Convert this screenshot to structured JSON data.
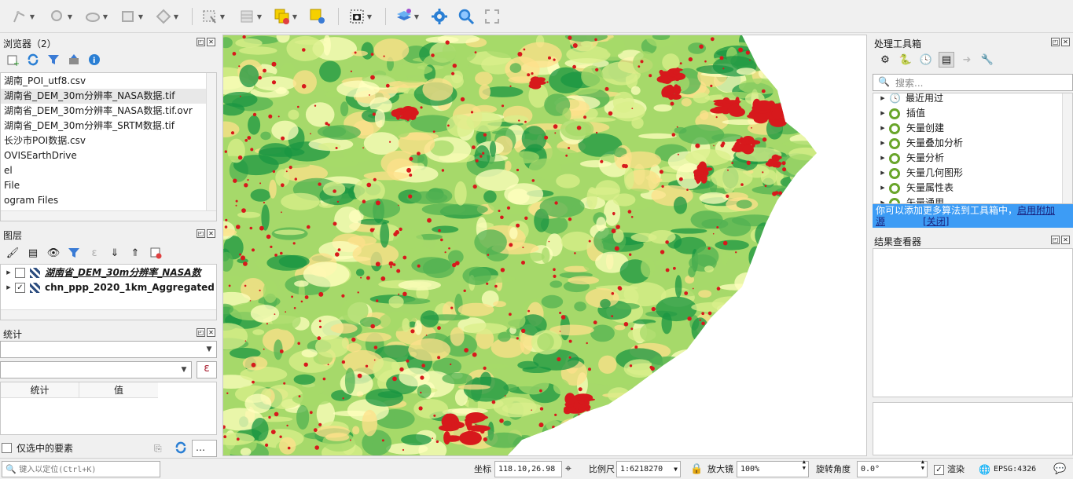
{
  "browser": {
    "title": "浏览器（2）",
    "items": [
      "湖南_POI_utf8.csv",
      "湖南省_DEM_30m分辨率_NASA数据.tif",
      "湖南省_DEM_30m分辨率_NASA数据.tif.ovr",
      "湖南省_DEM_30m分辨率_SRTM数据.tif",
      "长沙市POI数据.csv",
      "OVISEarthDrive",
      "el",
      "File",
      "ogram Files"
    ],
    "icons": [
      "add-layer-icon",
      "refresh-icon",
      "filter-icon",
      "collapse-icon",
      "info-icon"
    ]
  },
  "layers": {
    "title": "图层",
    "items": [
      {
        "name": "湖南省_DEM_30m分辨率_NASA数",
        "checked": false
      },
      {
        "name": "chn_ppp_2020_1km_Aggregated",
        "checked": true
      }
    ]
  },
  "stats": {
    "title": "统计",
    "field_button": "ε",
    "col_stat": "统计",
    "col_value": "值",
    "selected_only": "仅选中的要素",
    "more": "…"
  },
  "toolbox": {
    "title": "处理工具箱",
    "search_placeholder": "搜索...",
    "items": [
      "最近用过",
      "插值",
      "矢量创建",
      "矢量叠加分析",
      "矢量分析",
      "矢量几何图形",
      "矢量属性表",
      "矢量通用"
    ],
    "notice_text": "你可以添加更多算法到工具箱中，",
    "notice_link1": "启用附加",
    "notice_link1b": "源",
    "notice_link2": "[关闭]"
  },
  "results": {
    "title": "结果查看器"
  },
  "status": {
    "locate_placeholder": "键入以定位(Ctrl+K)",
    "coord_label": "坐标",
    "coord_value": "118.10,26.98",
    "scale_label": "比例尺",
    "scale_value": "1:6218270",
    "magnifier_label": "放大镜",
    "magnifier_value": "100%",
    "rotation_label": "旋转角度",
    "rotation_value": "0.0°",
    "render_label": "渲染",
    "crs": "EPSG:4326"
  },
  "colors": {
    "accent": "#3399ff",
    "notice": "#3d9cf5",
    "map_red": "#d7191c",
    "map_green": "#1a9641",
    "map_yellow": "#ffffbf"
  }
}
